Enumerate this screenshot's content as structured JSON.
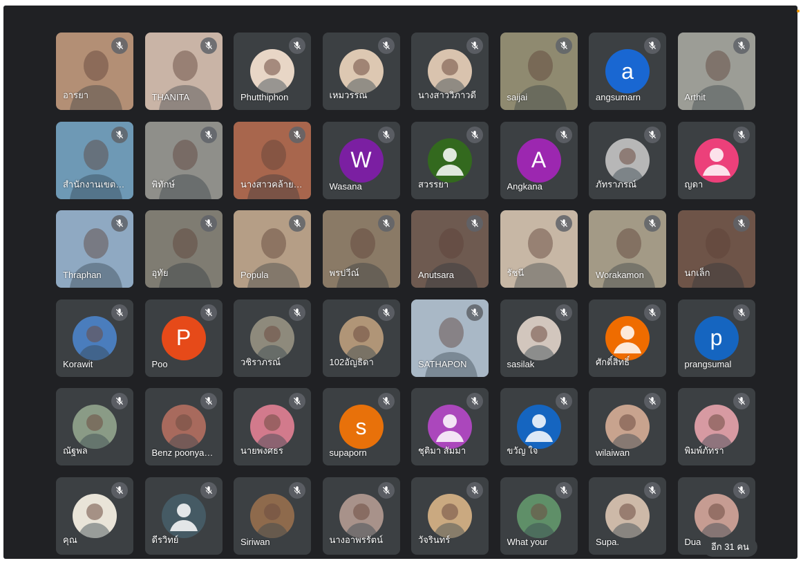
{
  "tiles": [
    {
      "name": "อารยา",
      "kind": "video",
      "bg": "#b38f75"
    },
    {
      "name": "THANITA",
      "kind": "video",
      "bg": "#c9b4a6"
    },
    {
      "name": "Phutthiphon",
      "kind": "photo",
      "bg": "#e8d6c6"
    },
    {
      "name": "เหมวรรณ",
      "kind": "photo",
      "bg": "#ddc8b2"
    },
    {
      "name": "นางสาววิภาวดี",
      "kind": "photo",
      "bg": "#d9c3ae"
    },
    {
      "name": "saijai",
      "kind": "video",
      "bg": "#8f8a70"
    },
    {
      "name": "angsumarn",
      "kind": "letter",
      "letter": "a",
      "color": "#1967d2"
    },
    {
      "name": "Arthit",
      "kind": "video",
      "bg": "#9c9d96"
    },
    {
      "name": "สำนักงานเขตพื้นที่",
      "kind": "video",
      "bg": "#6e99b5"
    },
    {
      "name": "พิทักษ์",
      "kind": "video",
      "bg": "#8f8f8a"
    },
    {
      "name": "นางสาวคล้ายจันทร์",
      "kind": "video",
      "bg": "#a8664d"
    },
    {
      "name": "Wasana",
      "kind": "letter",
      "letter": "W",
      "color": "#7b1fa2"
    },
    {
      "name": "สวรรยา",
      "kind": "default",
      "color": "#33691e"
    },
    {
      "name": "Angkana",
      "kind": "letter",
      "letter": "A",
      "color": "#9c27b0"
    },
    {
      "name": "ภัทราภรณ์",
      "kind": "photo",
      "bg": "#b7b7b7"
    },
    {
      "name": "ญดา",
      "kind": "default",
      "color": "#ec407a"
    },
    {
      "name": "Thraphan",
      "kind": "video",
      "bg": "#8fa9c2"
    },
    {
      "name": "อุทัย",
      "kind": "video",
      "bg": "#7f7c72"
    },
    {
      "name": "Popula",
      "kind": "video",
      "bg": "#b59e86"
    },
    {
      "name": "พรปวีณ์",
      "kind": "video",
      "bg": "#8a7a66"
    },
    {
      "name": "Anutsara",
      "kind": "video",
      "bg": "#6e5a50"
    },
    {
      "name": "รัชนี",
      "kind": "video",
      "bg": "#c7b7a5"
    },
    {
      "name": "Worakamon",
      "kind": "video",
      "bg": "#a39a86"
    },
    {
      "name": "นกเล็ก",
      "kind": "video",
      "bg": "#6e5448"
    },
    {
      "name": "Korawit",
      "kind": "photo",
      "bg": "#4a7dbd"
    },
    {
      "name": "Poo",
      "kind": "letter",
      "letter": "P",
      "color": "#e64a19"
    },
    {
      "name": "วชิราภรณ์",
      "kind": "photo",
      "bg": "#8e8a7c"
    },
    {
      "name": "102อัญธิดา",
      "kind": "photo",
      "bg": "#b09577"
    },
    {
      "name": "SATHAPON",
      "kind": "video",
      "bg": "#a9b8c6"
    },
    {
      "name": "sasilak",
      "kind": "photo",
      "bg": "#d2c6bd"
    },
    {
      "name": "ศักดิ์สิทธิ์",
      "kind": "default",
      "color": "#ef6c00"
    },
    {
      "name": "prangsumal",
      "kind": "letter",
      "letter": "p",
      "color": "#1565c0"
    },
    {
      "name": "ณัฐพล",
      "kind": "photo",
      "bg": "#8a9b86"
    },
    {
      "name": "Benz poonyaporn",
      "kind": "photo",
      "bg": "#a86a5d"
    },
    {
      "name": "นายพงศธร",
      "kind": "photo",
      "bg": "#d27a8c"
    },
    {
      "name": "supaporn",
      "kind": "letter",
      "letter": "s",
      "color": "#e8710a"
    },
    {
      "name": "ชุติมา สัมมา",
      "kind": "default",
      "color": "#ab47bc"
    },
    {
      "name": "ขวัญ ใจ",
      "kind": "default",
      "color": "#1565c0"
    },
    {
      "name": "wilaiwan",
      "kind": "photo",
      "bg": "#c8a38e"
    },
    {
      "name": "พิมพ์ภัทรา",
      "kind": "photo",
      "bg": "#d79aa2"
    },
    {
      "name": "คุณ",
      "kind": "photo",
      "bg": "#e9e4d8"
    },
    {
      "name": "ดีรวิทย์",
      "kind": "default",
      "color": "#455a64"
    },
    {
      "name": "Siriwan",
      "kind": "photo",
      "bg": "#8e6a4c"
    },
    {
      "name": "นางอาพรรัตน์",
      "kind": "photo",
      "bg": "#a8928a"
    },
    {
      "name": "วัจรินทร์",
      "kind": "photo",
      "bg": "#caa980"
    },
    {
      "name": "What your",
      "kind": "photo",
      "bg": "#5f8f68"
    },
    {
      "name": "Supa.",
      "kind": "photo",
      "bg": "#cdb9a8"
    },
    {
      "name": "Dua",
      "kind": "photo",
      "bg": "#c69c92"
    }
  ],
  "more_participants": "อีก 31 คน",
  "icons": {
    "mute": "mic-off-icon",
    "default_avatar": "person-icon"
  }
}
